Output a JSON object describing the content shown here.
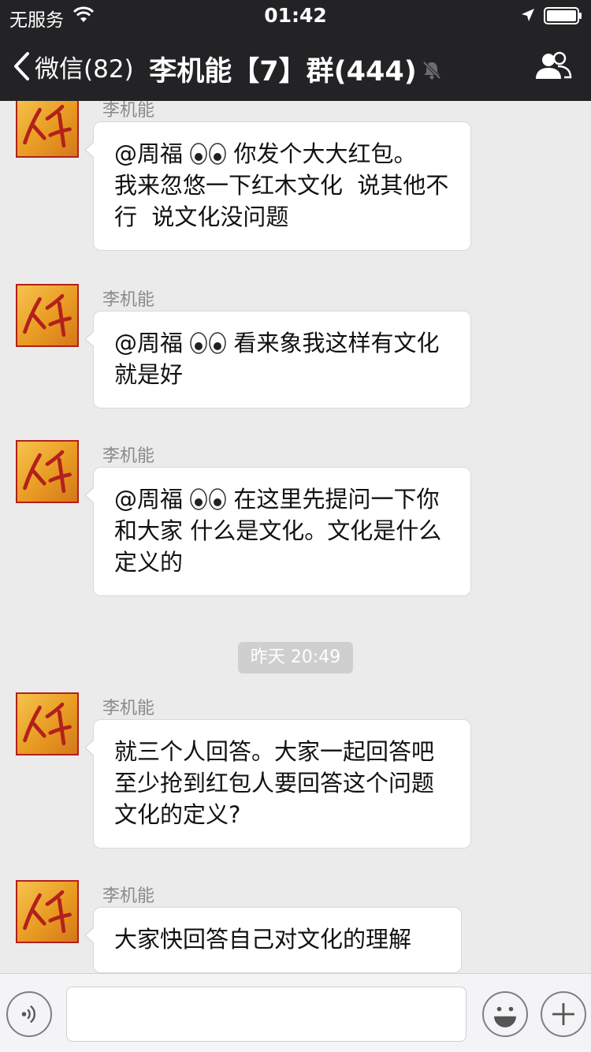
{
  "status_bar": {
    "carrier": "无服务",
    "time": "01:42"
  },
  "nav": {
    "back_label": "微信(82)",
    "title": "李机能【7】群(444)"
  },
  "messages": [
    {
      "sender": "李机能",
      "text_before": "@周福",
      "emoji": "eyes",
      "text_after": " 你发个大大红包。\n我来忽悠一下红木文化  说其他不行  说文化没问题"
    },
    {
      "sender": "李机能",
      "text_before": "@周福",
      "emoji": "eyes",
      "text_after": " 看来象我这样有文化就是好"
    },
    {
      "sender": "李机能",
      "text_before": "@周福",
      "emoji": "eyes",
      "text_after": " 在这里先提问一下你和大家 什么是文化。文化是什么定义的"
    },
    {
      "sender": "李机能",
      "text": "就三个人回答。大家一起回答吧  至少抢到红包人要回答这个问题  文化的定义?"
    },
    {
      "sender": "李机能",
      "text": "大家快回答自己对文化的理解"
    }
  ],
  "timestamp": "昨天 20:49",
  "colors": {
    "header_bg": "#232326",
    "chat_bg": "#ebebeb",
    "bubble_bg": "#ffffff",
    "avatar_red": "#b3201c",
    "avatar_gold": "#f0b53a"
  },
  "icons": {
    "back": "chevron-left-icon",
    "mute": "bell-slash-icon",
    "members": "group-icon",
    "voice": "voice-wave-icon",
    "emoji": "smiley-icon",
    "plus": "plus-icon"
  }
}
